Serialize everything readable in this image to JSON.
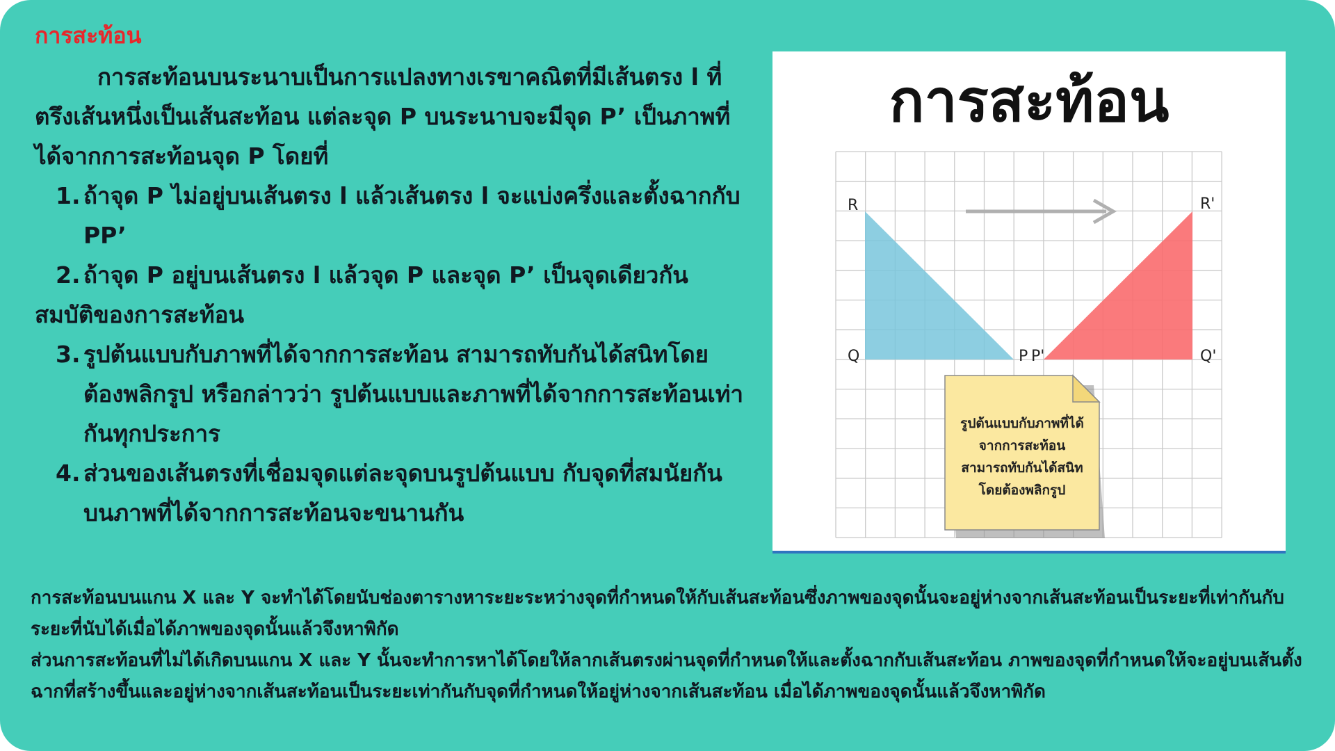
{
  "heading": "การสะท้อน",
  "intro": "การสะท้อนบนระนาบเป็นการแปลงทางเรขาคณิตที่มีเส้นตรง l ที่ตรึงเส้นหนึ่งเป็นเส้นสะท้อน แต่ละจุด P บนระนาบจะมีจุด P’ เป็นภาพที่ได้จากการสะท้อนจุด P โดยที่",
  "list_a": [
    {
      "num": "1.",
      "text": "ถ้าจุด P ไม่อยู่บนเส้นตรง l แล้วเส้นตรง l จะแบ่งครึ่งและตั้งฉากกับ PP’"
    },
    {
      "num": "2.",
      "text": "ถ้าจุด P อยู่บนเส้นตรง l แล้วจุด P และจุด P’ เป็นจุดเดียวกัน"
    }
  ],
  "subheading": "สมบัติของการสะท้อน",
  "list_b": [
    {
      "num": "3.",
      "text": "รูปต้นแบบกับภาพที่ได้จากการสะท้อน สามารถทับกันได้สนิทโดยต้องพลิกรูป หรือกล่าวว่า รูปต้นแบบและภาพที่ได้จากการสะท้อนเท่ากันทุกประการ"
    },
    {
      "num": "4.",
      "text": "ส่วนของเส้นตรงที่เชื่อมจุดแต่ละจุดบนรูปต้นแบบ กับจุดที่สมนัยกันบนภาพที่ได้จากการสะท้อนจะขนานกัน"
    }
  ],
  "bottom": [
    "การสะท้อนบนแกน X และ Y จะทำได้โดยนับช่องตารางหาระยะระหว่างจุดที่กำหนดให้กับเส้นสะท้อนซึ่งภาพของจุดนั้นจะอยู่ห่างจากเส้นสะท้อนเป็นระยะที่เท่ากันกับระยะที่นับได้เมื่อได้ภาพของจุดนั้นแล้วจึงหาพิกัด",
    "ส่วนการสะท้อนที่ไม่ได้เกิดบนแกน X และ Y นั้นจะทำการหาได้โดยให้ลากเส้นตรงผ่านจุดที่กำหนดให้และตั้งฉากกับเส้นสะท้อน ภาพของจุดที่กำหนดให้จะอยู่บนเส้นตั้งฉากที่สร้างขึ้นและอยู่ห่างจากเส้นสะท้อนเป็นระยะเท่ากันกับจุดที่กำหนดให้อยู่ห่างจากเส้นสะท้อน เมื่อได้ภาพของจุดนั้นแล้วจึงหาพิกัด"
  ],
  "figure": {
    "title": "การสะท้อน",
    "labels": {
      "R": "R",
      "Q": "Q",
      "P": "P",
      "P_prime": "P'",
      "R_prime": "R'",
      "Q_prime": "Q'"
    },
    "note_lines": [
      "รูปต้นแบบกับภาพที่ได้",
      "จากการสะท้อน",
      "สามารถทับกันได้สนิท",
      "โดยต้องพลิกรูป"
    ],
    "colors": {
      "original": "#79c6dc",
      "image": "#f96b6e",
      "note": "#fbe8a0",
      "arrow": "#b0b0b0"
    }
  },
  "colors": {
    "background": "#45cdb9",
    "heading": "#e8262b",
    "text": "#101820"
  }
}
